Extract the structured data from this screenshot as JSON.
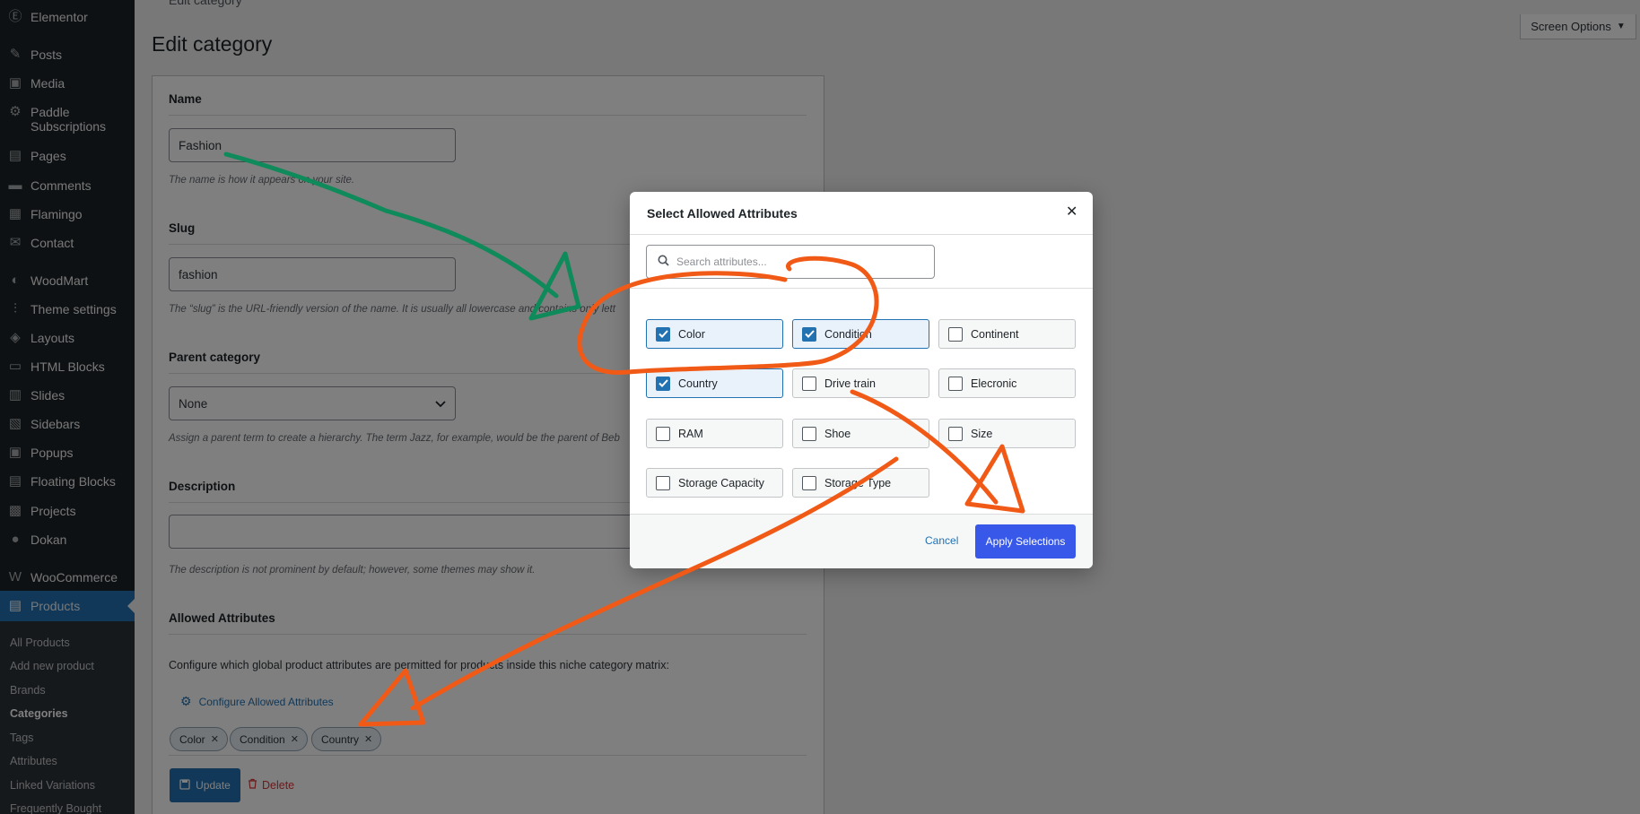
{
  "sidebar": {
    "top_item": {
      "label": "Elementor",
      "icon": "elementor-icon"
    },
    "items": [
      {
        "label": "Posts",
        "icon": "pin-icon"
      },
      {
        "label": "Media",
        "icon": "media-icon"
      },
      {
        "label": "Paddle",
        "label2": "Subscriptions",
        "icon": "gear-icon"
      },
      {
        "label": "Pages",
        "icon": "pages-icon"
      },
      {
        "label": "Comments",
        "icon": "comment-icon"
      },
      {
        "label": "Flamingo",
        "icon": "flamingo-icon"
      },
      {
        "label": "Contact",
        "icon": "mail-icon"
      },
      {
        "label": "WoodMart",
        "icon": "woodmart-icon"
      },
      {
        "label": "Theme settings",
        "icon": "sliders-icon"
      },
      {
        "label": "Layouts",
        "icon": "layers-icon"
      },
      {
        "label": "HTML Blocks",
        "icon": "html-icon"
      },
      {
        "label": "Slides",
        "icon": "slides-icon"
      },
      {
        "label": "Sidebars",
        "icon": "sidebar-icon"
      },
      {
        "label": "Popups",
        "icon": "popup-icon"
      },
      {
        "label": "Floating Blocks",
        "icon": "floating-icon"
      },
      {
        "label": "Projects",
        "icon": "briefcase-icon"
      },
      {
        "label": "Dokan",
        "icon": "dokan-icon"
      },
      {
        "label": "WooCommerce",
        "icon": "woo-icon"
      },
      {
        "label": "Products",
        "icon": "archive-icon",
        "active": true
      }
    ],
    "submenu": [
      "All Products",
      "Add new product",
      "Brands",
      "Categories",
      "Tags",
      "Attributes",
      "Linked Variations",
      "Frequently Bought"
    ],
    "current_submenu": "Categories"
  },
  "top_bar": {
    "breadcrumb": "Edit category",
    "screen_options": "Screen Options"
  },
  "page_title": "Edit category",
  "form": {
    "name_label": "Name",
    "name_value": "Fashion",
    "name_help": "The name is how it appears on your site.",
    "slug_label": "Slug",
    "slug_value": "fashion",
    "slug_help": "The “slug” is the URL-friendly version of the name. It is usually all lowercase and contains only lett",
    "parent_label": "Parent category",
    "parent_value": "None",
    "parent_help": "Assign a parent term to create a hierarchy. The term Jazz, for example, would be the parent of Beb",
    "description_label": "Description",
    "description_value": "",
    "description_help": "The description is not prominent by default; however, some themes may show it.",
    "allowed_label": "Allowed Attributes",
    "allowed_text": "Configure which global product attributes are permitted for products inside this niche category matrix:",
    "configure_link": "Configure Allowed Attributes",
    "chips": [
      "Color",
      "Condition",
      "Country"
    ],
    "update_label": "Update",
    "delete_label": "Delete"
  },
  "modal": {
    "title": "Select Allowed Attributes",
    "search_placeholder": "Search attributes...",
    "attributes": [
      {
        "label": "Color",
        "checked": true
      },
      {
        "label": "Condition",
        "checked": true
      },
      {
        "label": "Continent",
        "checked": false
      },
      {
        "label": "Country",
        "checked": true
      },
      {
        "label": "Drive train",
        "checked": false
      },
      {
        "label": "Elecronic",
        "checked": false
      },
      {
        "label": "RAM",
        "checked": false
      },
      {
        "label": "Shoe",
        "checked": false
      },
      {
        "label": "Size",
        "checked": false
      },
      {
        "label": "Storage Capacity",
        "checked": false
      },
      {
        "label": "Storage Type",
        "checked": false
      }
    ],
    "cancel_label": "Cancel",
    "apply_label": "Apply Selections"
  },
  "colors": {
    "admin_blue": "#2271b1",
    "apply_blue": "#3858e9",
    "annotation_orange": "#f15a16",
    "annotation_green": "#0f8a5a",
    "sidebar_bg": "#1d2327"
  }
}
